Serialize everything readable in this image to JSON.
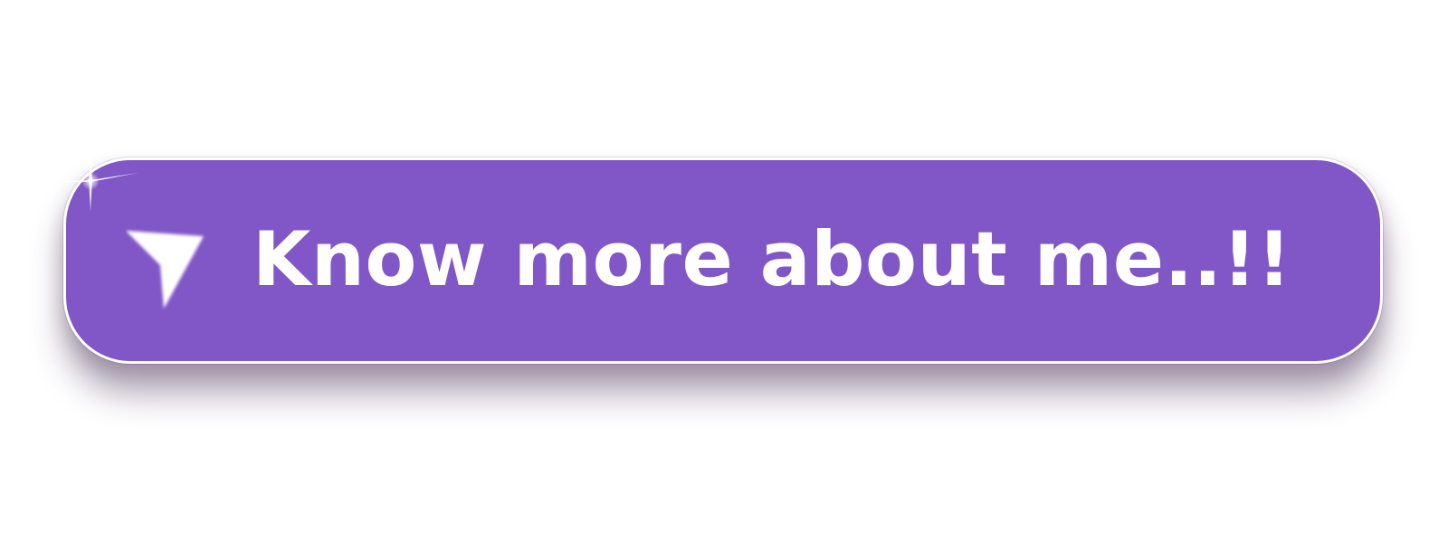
{
  "button": {
    "label": "Know more about me..!!",
    "icon": "cursor-arrow-icon",
    "colors": {
      "background": "#8157c7",
      "border": "#ffffff",
      "text": "#ffffff"
    }
  }
}
